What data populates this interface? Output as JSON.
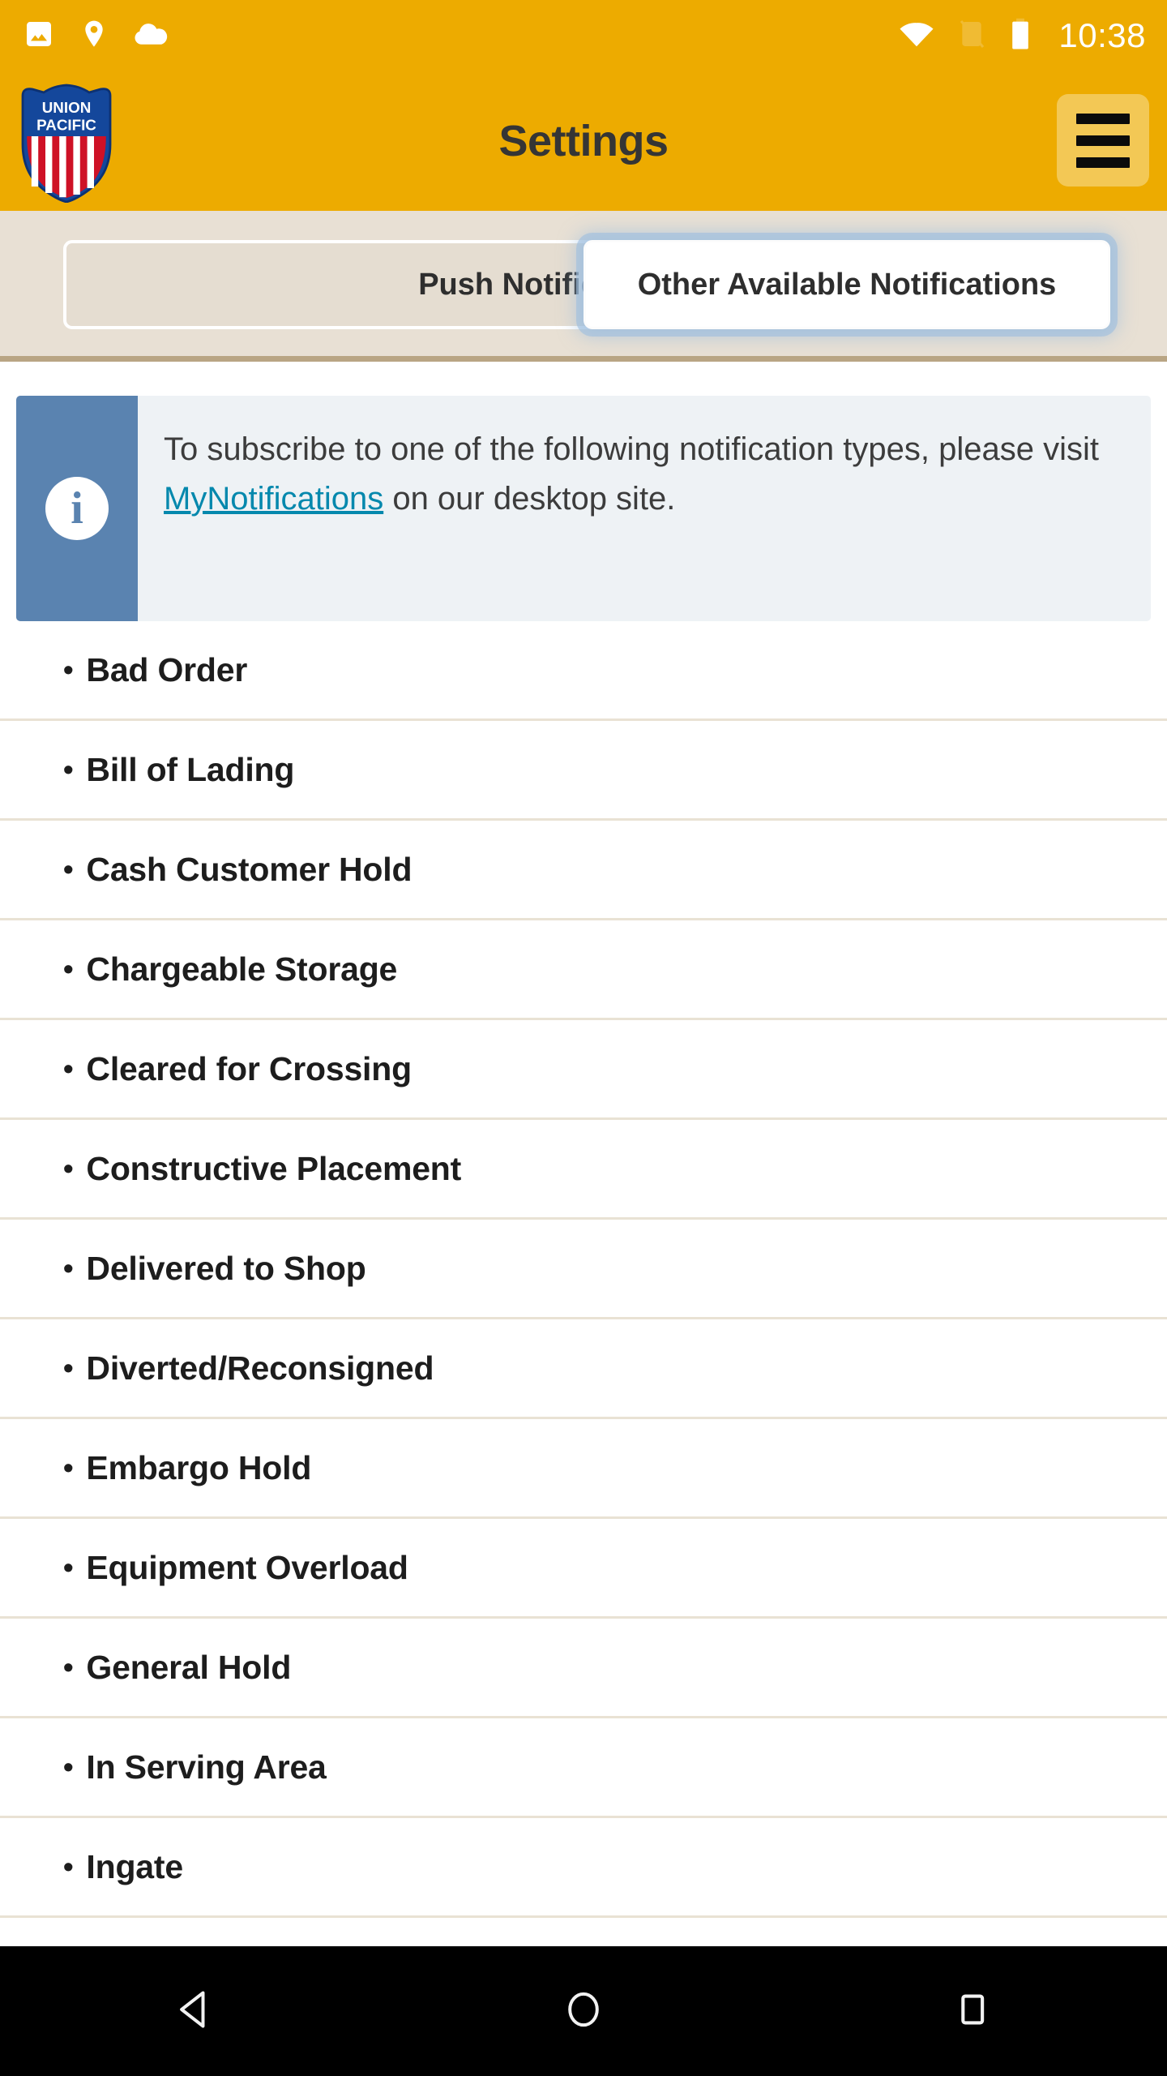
{
  "status_bar": {
    "clock": "10:38",
    "left_icons": [
      "image-icon",
      "location-pin-icon",
      "cloud-icon"
    ],
    "right_icons": [
      "wifi-icon",
      "sim-off-icon",
      "battery-icon"
    ],
    "background_color": "#edab00",
    "icon_color": "#ffffff"
  },
  "header": {
    "title": "Settings",
    "logo_line1": "UNION",
    "logo_line2": "PACIFIC",
    "logo_name": "union-pacific-shield-logo",
    "menu_icon": "hamburger-menu-icon",
    "background_color": "#edab00",
    "title_color": "#353535"
  },
  "tabs": {
    "background_color": "#e8e0d4",
    "divider_color": "#b9a584",
    "items": [
      {
        "label": "Push Notifications",
        "active": false
      },
      {
        "label": "Other Available Notifications",
        "active": true
      }
    ]
  },
  "info_banner": {
    "icon": "info-circle-icon",
    "band_color": "#5a83b0",
    "background_color": "#eef2f5",
    "link_color": "#0588ad",
    "text_before": "To subscribe to one of the following notification types, please visit ",
    "link_text": "MyNotifications",
    "text_after": " on our desktop site."
  },
  "notification_list": {
    "bullet": "•",
    "items": [
      "Bad Order",
      "Bill of Lading",
      "Cash Customer Hold",
      "Chargeable Storage",
      "Cleared for Crossing",
      "Constructive Placement",
      "Delivered to Shop",
      "Diverted/Reconsigned",
      "Embargo Hold",
      "Equipment Overload",
      "General Hold",
      "In Serving Area",
      "Ingate"
    ]
  },
  "navigation_bar": {
    "background_color": "#000000",
    "buttons": [
      {
        "name": "back-button",
        "icon": "back-triangle-icon"
      },
      {
        "name": "home-button",
        "icon": "home-circle-icon"
      },
      {
        "name": "recents-button",
        "icon": "recents-square-icon"
      }
    ]
  }
}
